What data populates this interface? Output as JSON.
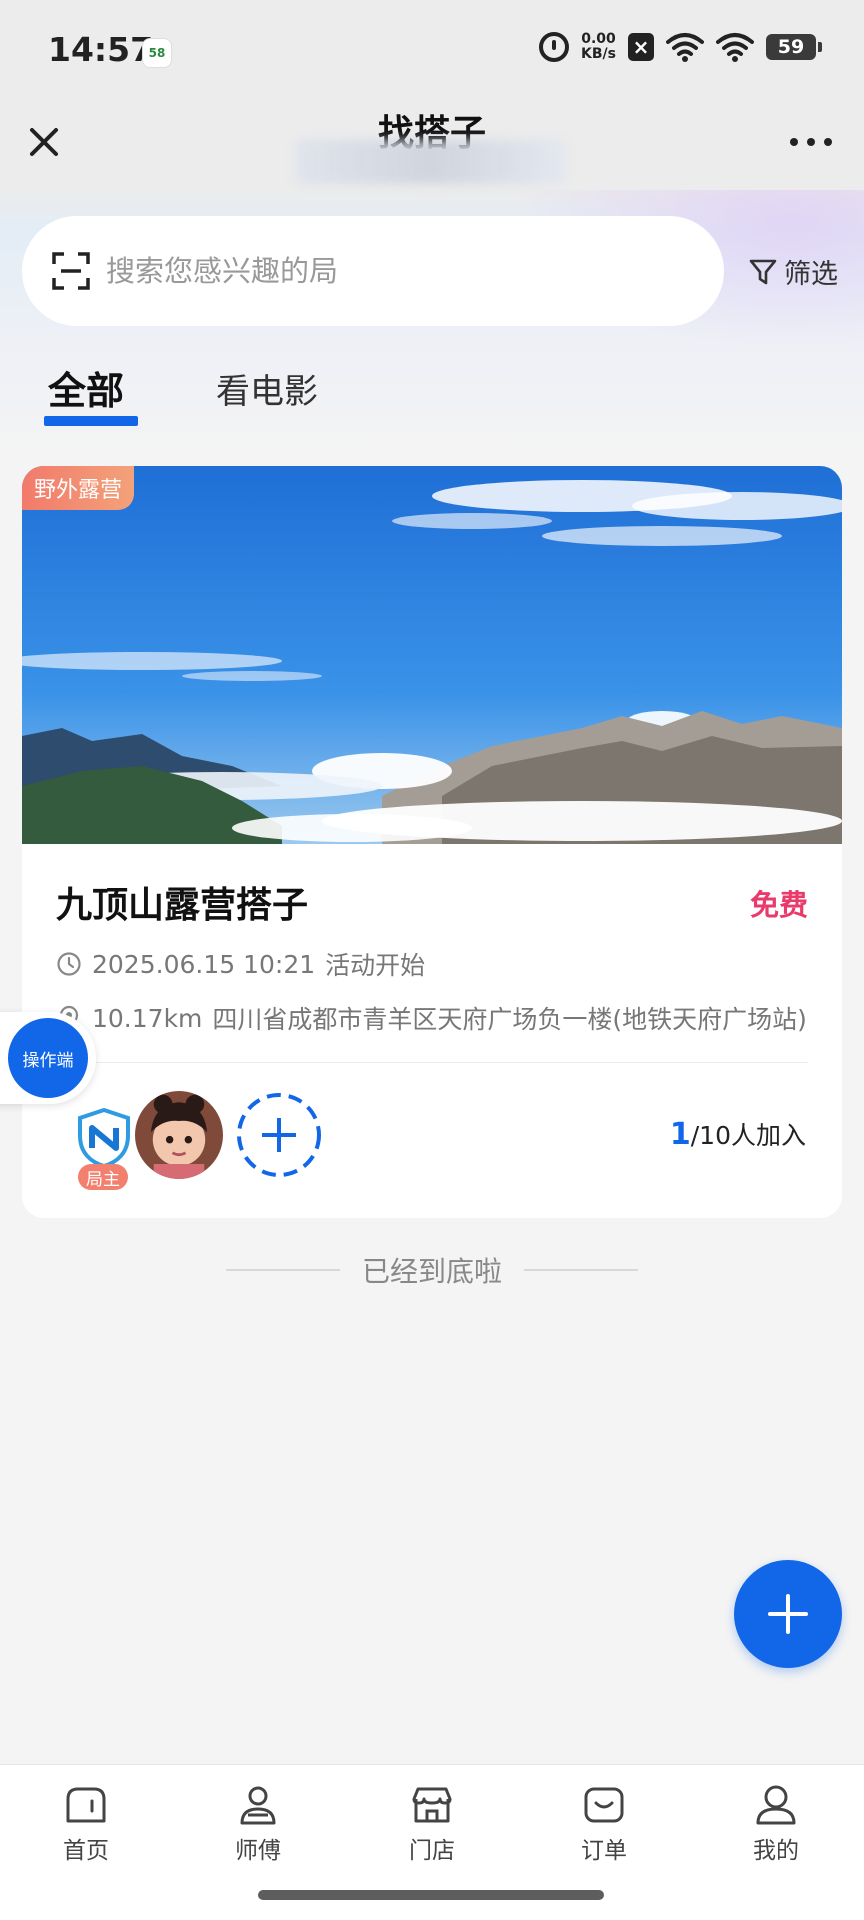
{
  "status_bar": {
    "time": "14:57",
    "app_icon_label": "58",
    "net_speed_value": "0.00",
    "net_speed_unit": "KB/s",
    "battery": "59"
  },
  "header": {
    "title": "找搭子"
  },
  "search": {
    "placeholder": "搜索您感兴趣的局",
    "filter_label": "筛选"
  },
  "tabs": [
    {
      "label": "全部",
      "active": true
    },
    {
      "label": "看电影",
      "active": false
    }
  ],
  "activity": {
    "category": "野外露营",
    "title": "九顶山露营搭子",
    "price": "免费",
    "time": "2025.06.15 10:21",
    "time_note": "活动开始",
    "distance": "10.17km",
    "address": "四川省成都市青羊区天府广场负一楼(地铁天府广场站)",
    "host_badge": "局主",
    "joined": "1",
    "capacity_text": "/10人加入"
  },
  "operator_button": "操作端",
  "end_note": "已经到底啦",
  "nav": [
    {
      "label": "首页",
      "icon": "home-icon"
    },
    {
      "label": "师傅",
      "icon": "worker-icon"
    },
    {
      "label": "门店",
      "icon": "store-icon"
    },
    {
      "label": "订单",
      "icon": "order-icon"
    },
    {
      "label": "我的",
      "icon": "profile-icon"
    }
  ],
  "colors": {
    "accent": "#1167e8",
    "price": "#ea3a6b",
    "tag": "#f27a6b"
  }
}
